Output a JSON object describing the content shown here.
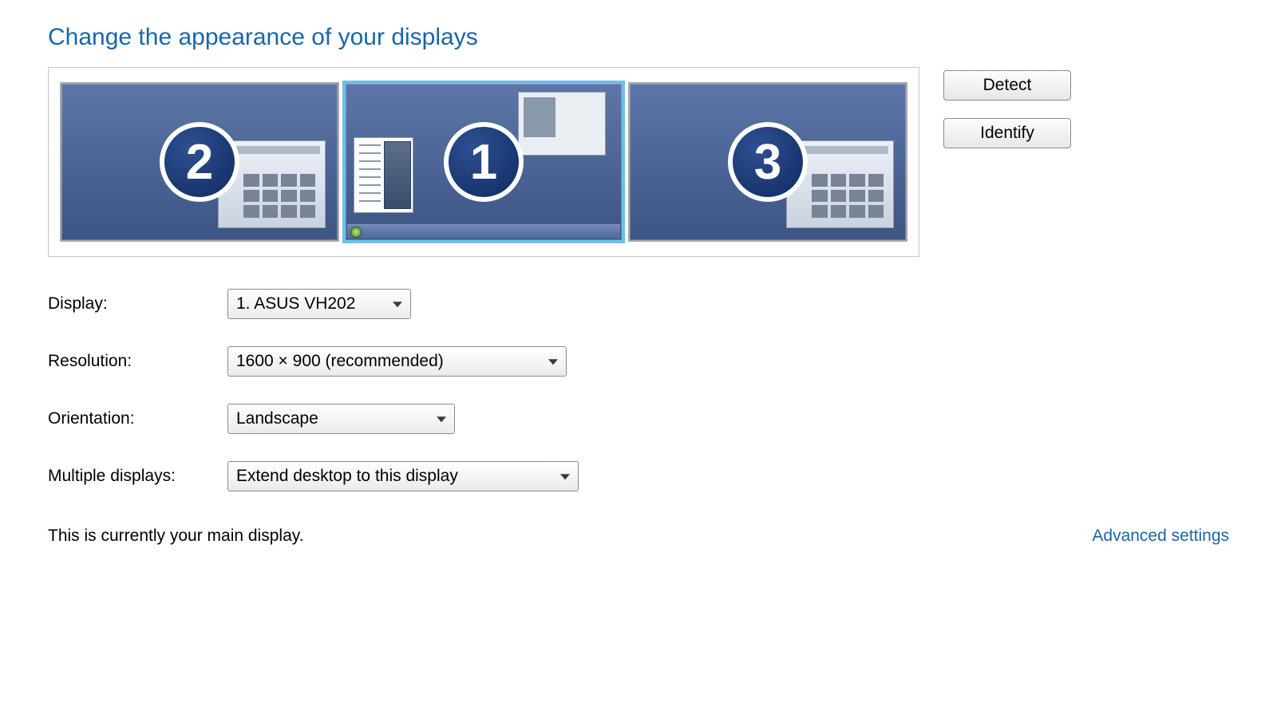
{
  "title": "Change the appearance of your displays",
  "monitors": [
    {
      "number": "2",
      "selected": false,
      "kind": "grid-app"
    },
    {
      "number": "1",
      "selected": true,
      "kind": "desktop"
    },
    {
      "number": "3",
      "selected": false,
      "kind": "grid-app"
    }
  ],
  "buttons": {
    "detect": "Detect",
    "identify": "Identify"
  },
  "form": {
    "display_label": "Display:",
    "display_value": "1. ASUS VH202",
    "resolution_label": "Resolution:",
    "resolution_value": "1600 × 900 (recommended)",
    "orientation_label": "Orientation:",
    "orientation_value": "Landscape",
    "multiple_label": "Multiple displays:",
    "multiple_value": "Extend desktop to this display"
  },
  "status_text": "This is currently your main display.",
  "advanced_link": "Advanced settings"
}
